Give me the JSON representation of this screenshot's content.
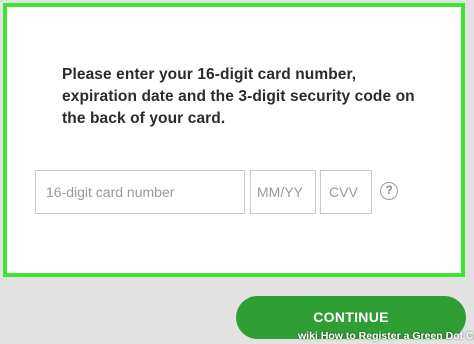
{
  "form": {
    "instructions": "Please enter your 16-digit card number, expiration date and the 3-digit security code on the back of your card.",
    "card_number_placeholder": "16-digit card number",
    "expiry_placeholder": "MM/YY",
    "cvv_placeholder": "CVV",
    "help_icon_glyph": "?"
  },
  "actions": {
    "continue_label": "CONTINUE"
  },
  "watermark": {
    "brand": "wiki",
    "title": "How to Register a Green Dot Card"
  },
  "colors": {
    "highlight_border": "#3ee52e",
    "button_green": "#2f9e35",
    "background": "#e2e2e2"
  },
  "icons": {
    "help": "help-icon"
  }
}
